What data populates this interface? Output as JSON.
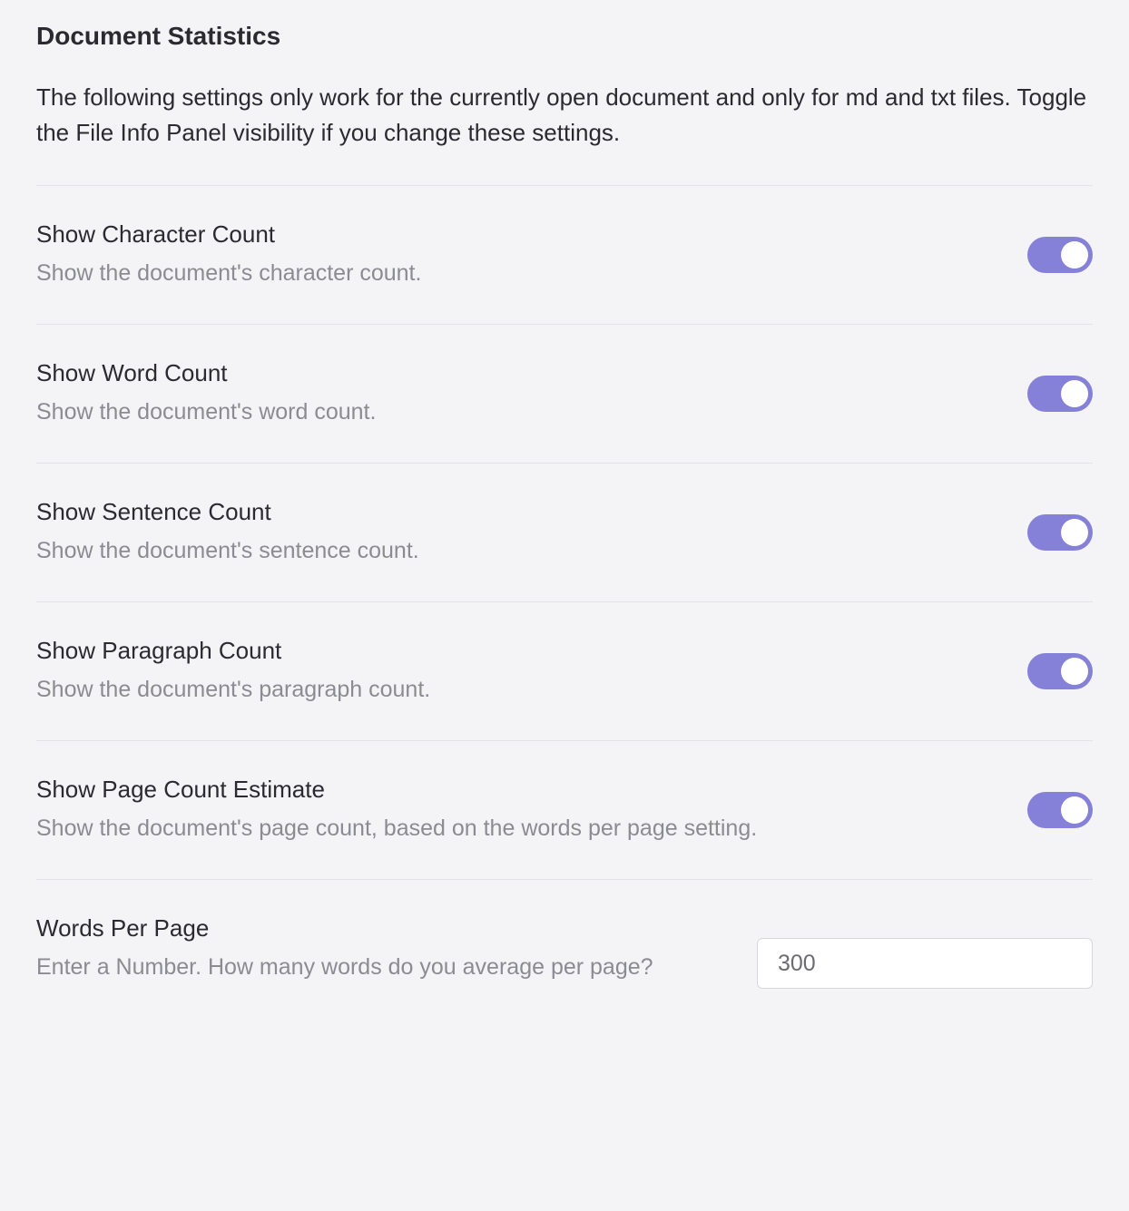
{
  "section": {
    "title": "Document Statistics",
    "description": "The following settings only work for the currently open document and only for md and txt files. Toggle the File Info Panel visibility if you change these settings."
  },
  "settings": {
    "character_count": {
      "title": "Show Character Count",
      "desc": "Show the document's character count.",
      "enabled": true
    },
    "word_count": {
      "title": "Show Word Count",
      "desc": "Show the document's word count.",
      "enabled": true
    },
    "sentence_count": {
      "title": "Show Sentence Count",
      "desc": "Show the document's sentence count.",
      "enabled": true
    },
    "paragraph_count": {
      "title": "Show Paragraph Count",
      "desc": "Show the document's paragraph count.",
      "enabled": true
    },
    "page_count": {
      "title": "Show Page Count Estimate",
      "desc": "Show the document's page count, based on the words per page setting.",
      "enabled": true
    },
    "words_per_page": {
      "title": "Words Per Page",
      "desc": "Enter a Number. How many words do you average per page?",
      "value": "300"
    }
  },
  "colors": {
    "toggle_on": "#8580d8"
  }
}
